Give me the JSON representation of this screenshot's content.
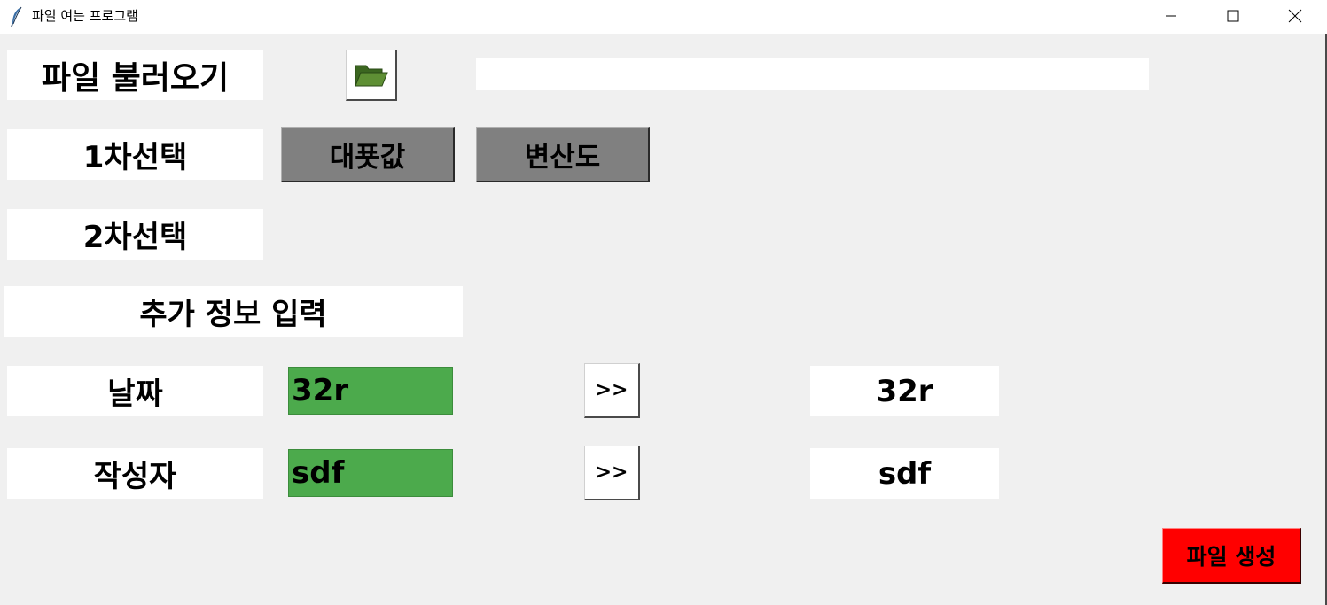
{
  "window": {
    "title": "파일 여는 프로그램",
    "icon": "feather-icon",
    "controls": [
      "minimize-icon",
      "maximize-icon",
      "close-icon"
    ]
  },
  "file_load": {
    "label": "파일 불러오기",
    "open_icon": "folder-open-icon",
    "path_value": ""
  },
  "first_selection": {
    "label": "1차선택",
    "options": [
      "대푯값",
      "변산도"
    ]
  },
  "second_selection": {
    "label": "2차선택"
  },
  "additional_info": {
    "label": "추가 정보 입력"
  },
  "date_row": {
    "label": "날짜",
    "input_value": "32r",
    "arrow_label": ">>",
    "result": "32r"
  },
  "author_row": {
    "label": "작성자",
    "input_value": "sdf",
    "arrow_label": ">>",
    "result": "sdf"
  },
  "generate_button": {
    "label": "파일 생성"
  },
  "colors": {
    "background": "#f0f0f0",
    "input_green": "#4caa4c",
    "button_gray": "#808080",
    "generate_red": "#ff0000",
    "folder_green": "#4a7a2a"
  }
}
